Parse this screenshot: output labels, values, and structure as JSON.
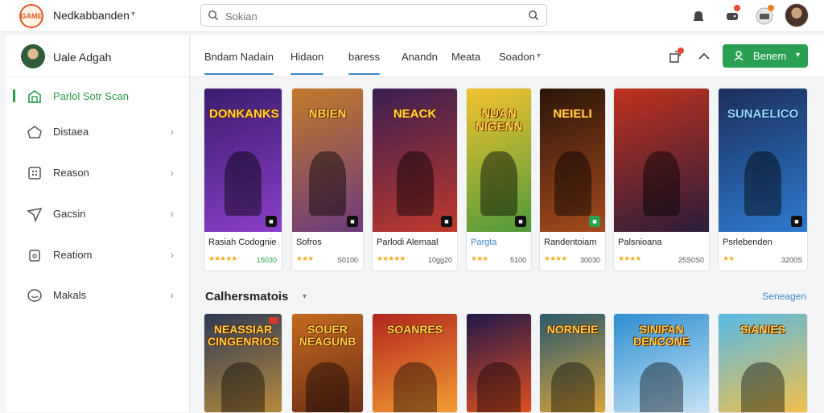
{
  "header": {
    "logo_text": "GAME",
    "app_title": "Nedkabbanden",
    "search_placeholder": "Sokian"
  },
  "user": {
    "name": "Uale Adgah"
  },
  "sidebar": {
    "items": [
      {
        "label": "Parlol Sotr Scan",
        "icon": "store-icon",
        "active": true
      },
      {
        "label": "Distaea",
        "icon": "home-icon"
      },
      {
        "label": "Reason",
        "icon": "grid-icon"
      },
      {
        "label": "Gacsin",
        "icon": "send-icon"
      },
      {
        "label": "Reatiom",
        "icon": "lock-icon"
      },
      {
        "label": "Makals",
        "icon": "chat-icon"
      }
    ]
  },
  "tabs": [
    {
      "label": "Bndam Nadain",
      "active": true
    },
    {
      "label": "Hidaon",
      "active": true
    },
    {
      "label": "baress",
      "active": true
    },
    {
      "label": "Anandn"
    },
    {
      "label": "Meata"
    },
    {
      "label": "Soadon"
    }
  ],
  "toolbar": {
    "primary_button": "Benem"
  },
  "games": [
    {
      "title": "DONKANKS",
      "name": "Rasiah Codognie",
      "stars": "★★★★★",
      "price": "15030",
      "bg": [
        "#3b1c6e",
        "#8a3fc9"
      ]
    },
    {
      "title": "NBIEN",
      "name": "Sofros",
      "stars": "★★★",
      "price": "S0100",
      "bg": [
        "#c27a2a",
        "#6b3a7d"
      ]
    },
    {
      "title": "NEACK",
      "name": "Parlodi Alemaal",
      "stars": "★★★★★",
      "price": "10gg20",
      "bg": [
        "#3a1f52",
        "#c0392b"
      ]
    },
    {
      "title": "NUAN NIGENN",
      "name": "Pargta",
      "stars": "★★★",
      "price": "5100",
      "bg": [
        "#f2c230",
        "#4e9a3a"
      ]
    },
    {
      "title": "NEIELI",
      "name": "Randentoiam",
      "stars": "★★★★",
      "price": "30030",
      "bg": [
        "#2b1608",
        "#a54a1d"
      ]
    },
    {
      "title": "",
      "name": "Palsnioana",
      "stars": "★★★★",
      "price": "25S0S0",
      "bg": [
        "#c0321e",
        "#2b1d3b"
      ]
    },
    {
      "title": "SUNAELICO",
      "name": "Psrlebenden",
      "stars": "★★",
      "price": "3200S",
      "bg": [
        "#1c2f5b",
        "#2e7ad1"
      ]
    }
  ],
  "section": {
    "title": "Calhersmatois",
    "link": "Seneagen"
  },
  "games_row2": [
    {
      "title": "NEASSIAR CINGENRIOS",
      "bg": [
        "#2f3a55",
        "#b78a3c"
      ]
    },
    {
      "title": "SOUER NEAGUNB",
      "bg": [
        "#c46a1f",
        "#6c2d17"
      ]
    },
    {
      "title": "SOANRES",
      "bg": [
        "#b3261e",
        "#f39c32"
      ]
    },
    {
      "title": "",
      "bg": [
        "#20184a",
        "#e24f1f"
      ]
    },
    {
      "title": "NORNEIE",
      "bg": [
        "#2a5a6e",
        "#d9a23b"
      ]
    },
    {
      "title": "SINIFAN DENCONE",
      "bg": [
        "#2e8fd1",
        "#c5e3f5"
      ]
    },
    {
      "title": "SIANIES",
      "bg": [
        "#56b9e6",
        "#f2c04a"
      ]
    }
  ]
}
